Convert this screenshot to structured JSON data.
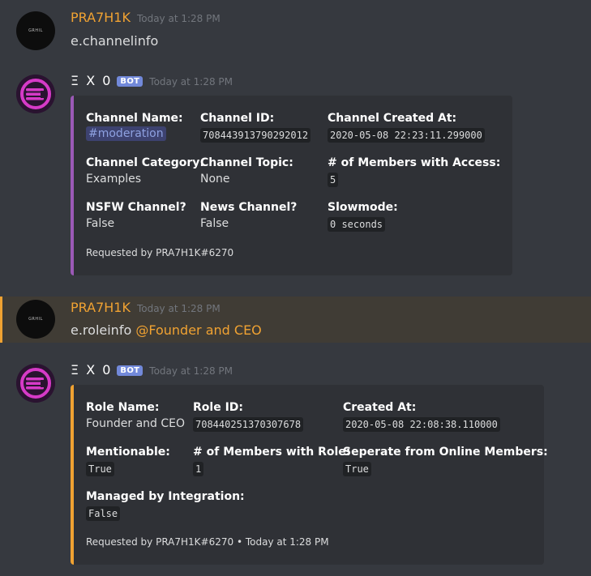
{
  "colors": {
    "background": "#36393f",
    "embed_bg": "#2f3136",
    "channel_embed_accent": "#9b59b6",
    "role_embed_accent": "#f0a232",
    "user_name": "#f0a232",
    "bot_tag": "#7289da",
    "highlight": "#403c35"
  },
  "messages": [
    {
      "author": "PRA7H1K",
      "timestamp": "Today at 1:28 PM",
      "avatar_text": "GRHIL",
      "content": "e.channelinfo"
    },
    {
      "author": "Ξ X 0",
      "bot_tag": "BOT",
      "timestamp": "Today at 1:28 PM",
      "embed": {
        "fields": [
          {
            "name": "Channel Name:",
            "value": "#moderation"
          },
          {
            "name": "Channel ID:",
            "value": "708443913790292012"
          },
          {
            "name": "Channel Created At:",
            "value": "2020-05-08 22:23:11.299000"
          },
          {
            "name": "Channel Category:",
            "value": "Examples"
          },
          {
            "name": "Channel Topic:",
            "value": "None"
          },
          {
            "name": "# of Members with Access:",
            "value": "5"
          },
          {
            "name": "NSFW Channel?",
            "value": "False"
          },
          {
            "name": "News Channel?",
            "value": "False"
          },
          {
            "name": "Slowmode:",
            "value": "0 seconds"
          }
        ],
        "footer": "Requested by PRA7H1K#6270"
      }
    },
    {
      "author": "PRA7H1K",
      "timestamp": "Today at 1:28 PM",
      "avatar_text": "GRHIL",
      "content_prefix": "e.roleinfo",
      "mention": "@Founder and CEO"
    },
    {
      "author": "Ξ X 0",
      "bot_tag": "BOT",
      "timestamp": "Today at 1:28 PM",
      "embed": {
        "fields": [
          {
            "name": "Role Name:",
            "value": "Founder and CEO"
          },
          {
            "name": "Role ID:",
            "value": "708440251370307678"
          },
          {
            "name": "Created At:",
            "value": "2020-05-08 22:08:38.110000"
          },
          {
            "name": "Mentionable:",
            "value": "True"
          },
          {
            "name": "# of Members with Role:",
            "value": "1"
          },
          {
            "name": "Seperate from Online Members:",
            "value": "True"
          },
          {
            "name": "Managed by Integration:",
            "value": "False"
          }
        ],
        "footer": "Requested by PRA7H1K#6270 • Today at 1:28 PM"
      }
    }
  ]
}
